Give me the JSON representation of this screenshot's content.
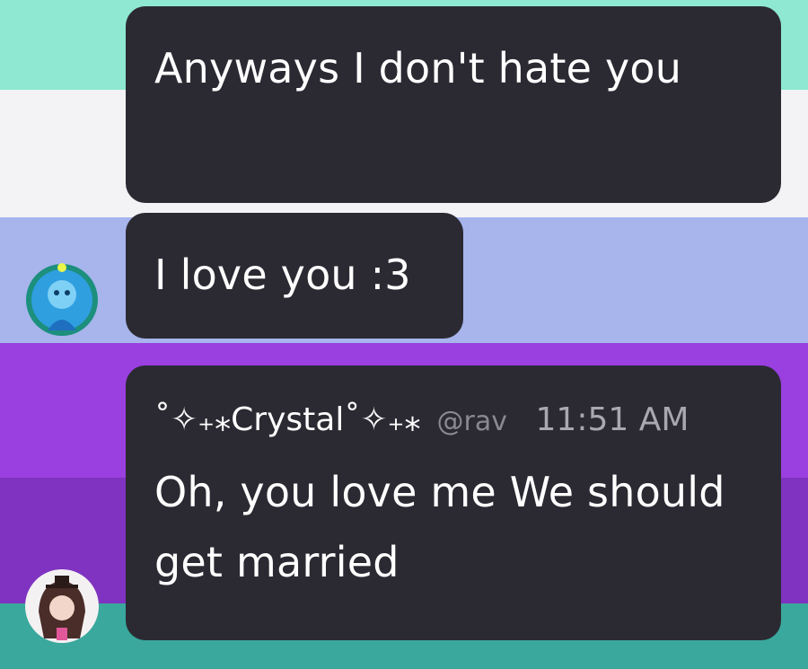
{
  "messages": [
    {
      "text": "Anyways I don't hate you"
    },
    {
      "text": "I love you :3"
    },
    {
      "username": "˚✧₊⁎Crystal˚✧₊⁎",
      "handle": "@rav",
      "time": "11:51 AM",
      "text": "Oh, you love me We should get married"
    }
  ],
  "colors": {
    "bubble": "#2b2a33",
    "text": "#ffffff",
    "muted": "#8a8893"
  }
}
